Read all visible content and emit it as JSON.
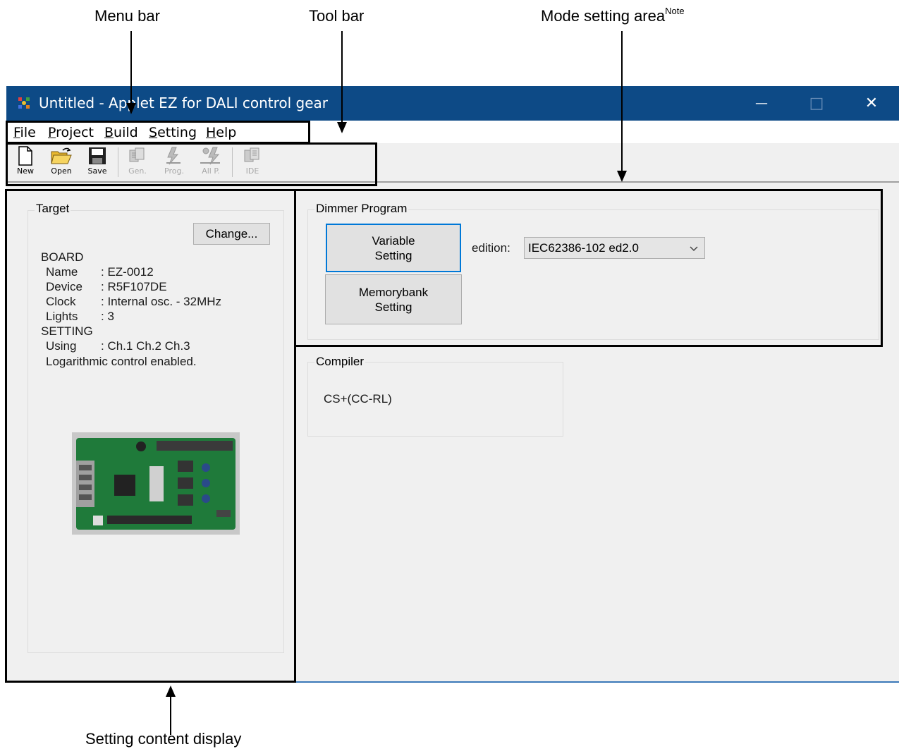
{
  "annotations": {
    "menu_bar": "Menu bar",
    "tool_bar": "Tool bar",
    "mode_setting_area": "Mode setting area",
    "mode_setting_note": "Note",
    "setting_content_display": "Setting content display"
  },
  "window": {
    "title": "Untitled - Applet EZ for DALI control gear",
    "minimize": "—",
    "maximize": "□",
    "close": "✕"
  },
  "menu": [
    {
      "mnemonic": "F",
      "rest": "ile"
    },
    {
      "mnemonic": "P",
      "rest": "roject"
    },
    {
      "mnemonic": "B",
      "rest": "uild"
    },
    {
      "mnemonic": "S",
      "rest": "etting"
    },
    {
      "mnemonic": "H",
      "rest": "elp"
    }
  ],
  "toolbar": {
    "new": "New",
    "open": "Open",
    "save": "Save",
    "gen": "Gen.",
    "prog": "Prog.",
    "allp": "All P.",
    "ide": "IDE"
  },
  "target": {
    "group_title": "Target",
    "change_button": "Change...",
    "board_heading": "BOARD",
    "name_label": "Name",
    "name_value": ": EZ-0012",
    "device_label": "Device",
    "device_value": ": R5F107DE",
    "clock_label": "Clock",
    "clock_value": ": Internal osc. - 32MHz",
    "lights_label": "Lights",
    "lights_value": ": 3",
    "setting_heading": "SETTING",
    "using_label": "Using",
    "using_value": ": Ch.1 Ch.2 Ch.3",
    "log_control": "Logarithmic control enabled."
  },
  "dimmer": {
    "group_title": "Dimmer Program",
    "variable_line1": "Variable",
    "variable_line2": "Setting",
    "memorybank_line1": "Memorybank",
    "memorybank_line2": "Setting",
    "edition_label": "edition:",
    "edition_value": "IEC62386-102 ed2.0"
  },
  "compiler": {
    "group_title": "Compiler",
    "value": "CS+(CC-RL)"
  },
  "colors": {
    "titlebar": "#0d4a86",
    "focus": "#0078d7",
    "pcb": "#1f7a3a"
  }
}
